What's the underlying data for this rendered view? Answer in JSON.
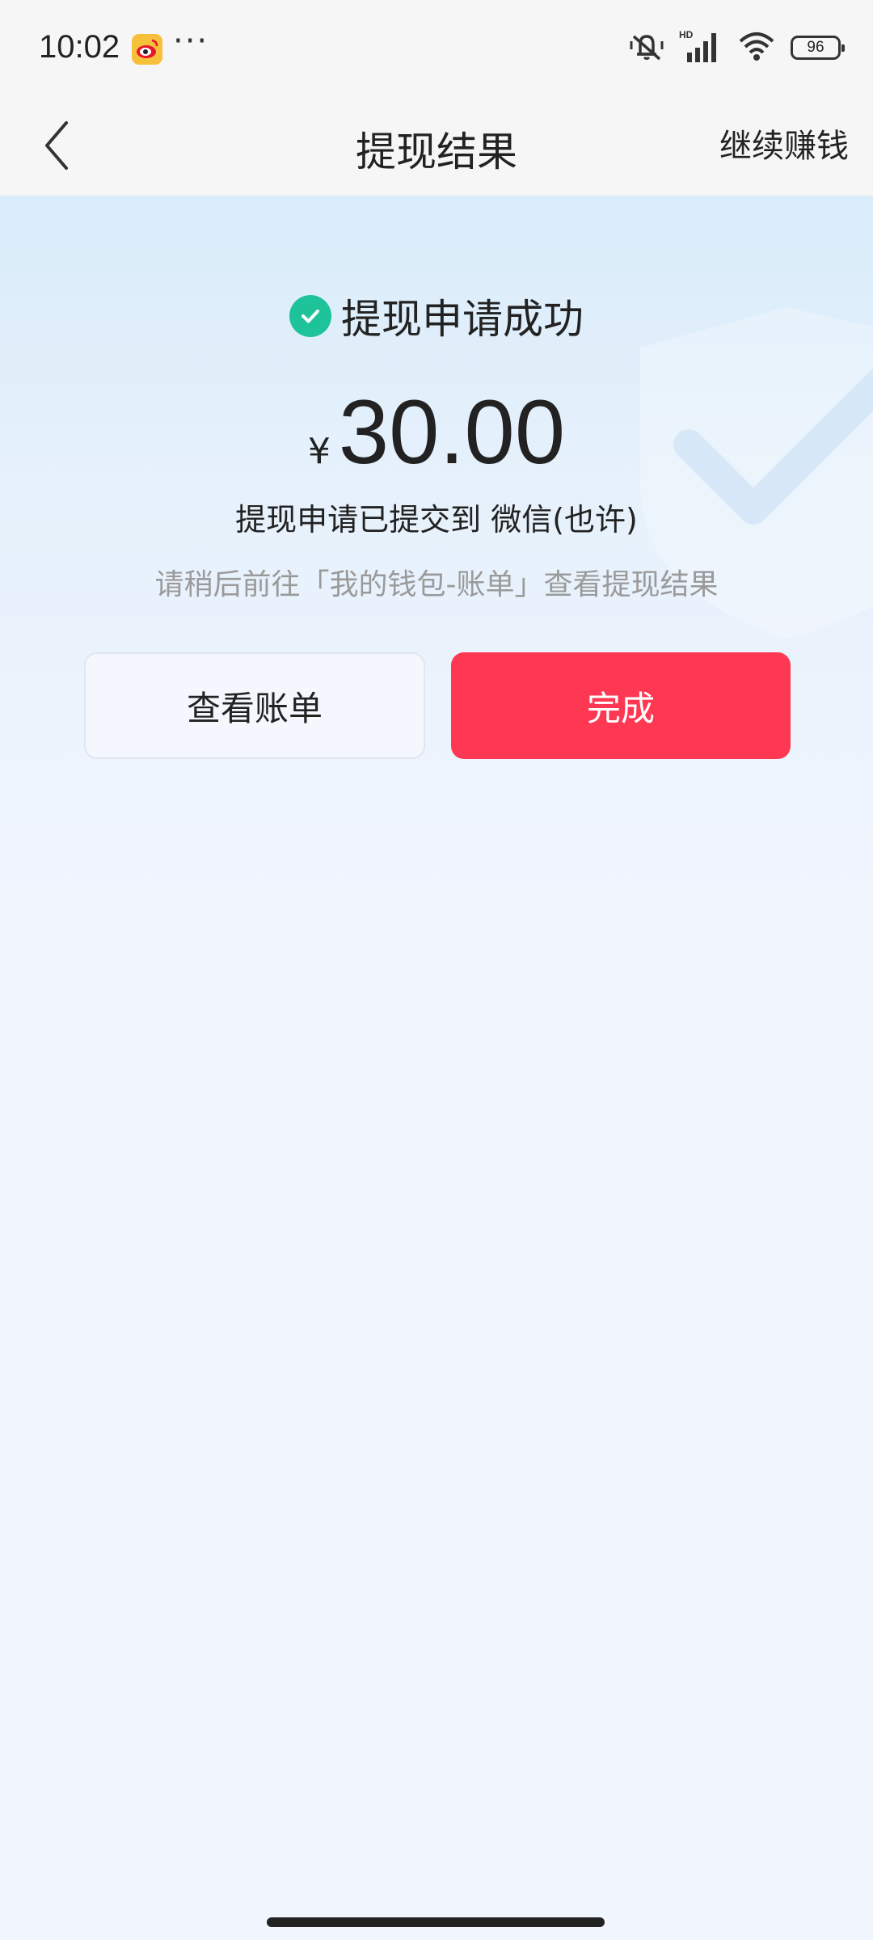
{
  "status_bar": {
    "time": "10:02",
    "dots": "···",
    "icons": [
      "mute-vibrate-icon",
      "hd-signal-icon",
      "wifi-icon"
    ],
    "battery": "96"
  },
  "nav": {
    "title": "提现结果",
    "action": "继续赚钱"
  },
  "result": {
    "status_title": "提现申请成功",
    "currency": "¥",
    "amount": "30.00",
    "submitted": "提现申请已提交到 微信(也许)",
    "hint": "请稍后前往「我的钱包-账单」查看提现结果",
    "check_color": "#1ec39a"
  },
  "buttons": {
    "view_bill": "查看账单",
    "done": "完成",
    "done_color": "#fe3853"
  }
}
